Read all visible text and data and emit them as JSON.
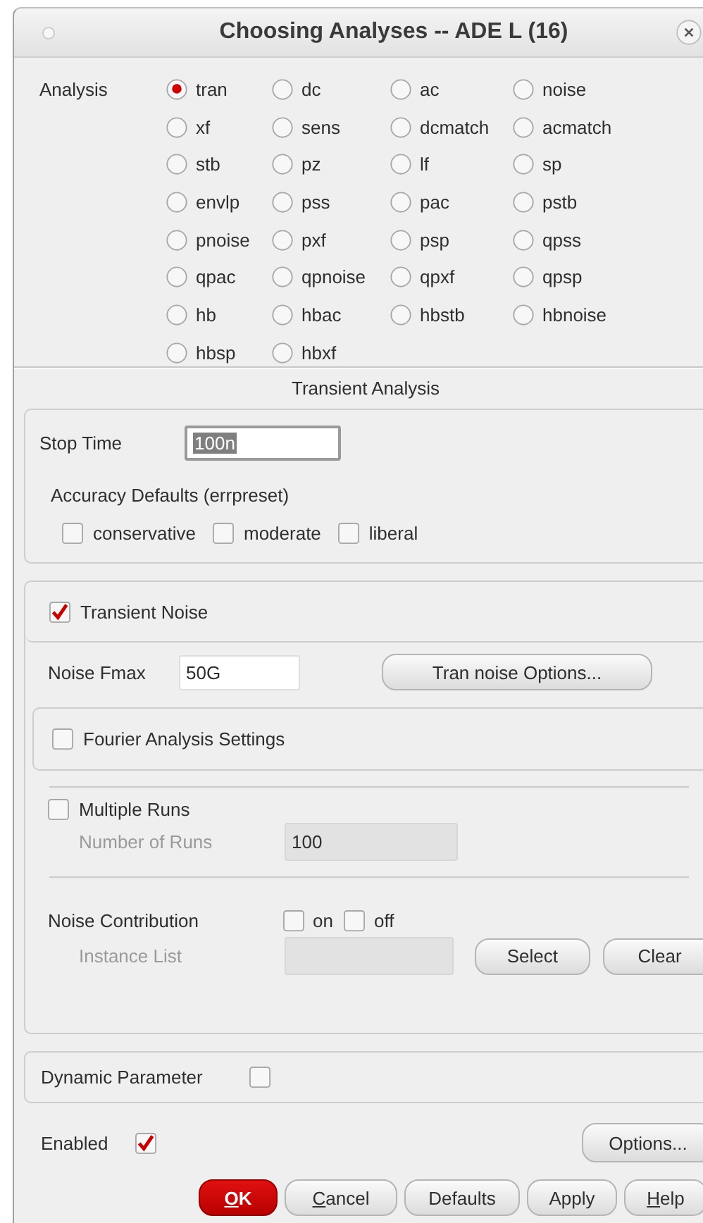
{
  "window": {
    "title": "Choosing Analyses -- ADE L (16)"
  },
  "analysis": {
    "label": "Analysis",
    "options": [
      {
        "label": "tran",
        "selected": true
      },
      {
        "label": "dc",
        "selected": false
      },
      {
        "label": "ac",
        "selected": false
      },
      {
        "label": "noise",
        "selected": false
      },
      {
        "label": "xf",
        "selected": false
      },
      {
        "label": "sens",
        "selected": false
      },
      {
        "label": "dcmatch",
        "selected": false
      },
      {
        "label": "acmatch",
        "selected": false
      },
      {
        "label": "stb",
        "selected": false
      },
      {
        "label": "pz",
        "selected": false
      },
      {
        "label": "lf",
        "selected": false
      },
      {
        "label": "sp",
        "selected": false
      },
      {
        "label": "envlp",
        "selected": false
      },
      {
        "label": "pss",
        "selected": false
      },
      {
        "label": "pac",
        "selected": false
      },
      {
        "label": "pstb",
        "selected": false
      },
      {
        "label": "pnoise",
        "selected": false
      },
      {
        "label": "pxf",
        "selected": false
      },
      {
        "label": "psp",
        "selected": false
      },
      {
        "label": "qpss",
        "selected": false
      },
      {
        "label": "qpac",
        "selected": false
      },
      {
        "label": "qpnoise",
        "selected": false
      },
      {
        "label": "qpxf",
        "selected": false
      },
      {
        "label": "qpsp",
        "selected": false
      },
      {
        "label": "hb",
        "selected": false
      },
      {
        "label": "hbac",
        "selected": false
      },
      {
        "label": "hbstb",
        "selected": false
      },
      {
        "label": "hbnoise",
        "selected": false
      },
      {
        "label": "hbsp",
        "selected": false
      },
      {
        "label": "hbxf",
        "selected": false
      }
    ]
  },
  "section_title": "Transient Analysis",
  "stop_time": {
    "label": "Stop Time",
    "value": "100n",
    "text_selected": true
  },
  "accuracy": {
    "label": "Accuracy Defaults (errpreset)",
    "options": [
      {
        "label": "conservative",
        "checked": false
      },
      {
        "label": "moderate",
        "checked": false
      },
      {
        "label": "liberal",
        "checked": false
      }
    ]
  },
  "transient_noise": {
    "label": "Transient Noise",
    "checked": true,
    "fmax": {
      "label": "Noise Fmax",
      "value": "50G"
    },
    "options_button": "Tran noise Options...",
    "fourier": {
      "label": "Fourier Analysis Settings",
      "checked": false
    },
    "multiple_runs": {
      "label": "Multiple Runs",
      "checked": false,
      "runs": {
        "label": "Number of Runs",
        "value": "100",
        "disabled": true
      }
    },
    "noise_contribution": {
      "label": "Noise Contribution",
      "options": [
        {
          "label": "on",
          "checked": false
        },
        {
          "label": "off",
          "checked": false
        }
      ],
      "instance_list": {
        "label": "Instance List",
        "disabled": true
      },
      "buttons": [
        "Select",
        "Clear"
      ]
    }
  },
  "dynamic_parameter": {
    "label": "Dynamic Parameter",
    "checked": false
  },
  "enabled": {
    "label": "Enabled",
    "checked": true
  },
  "options_button": "Options...",
  "buttons": [
    {
      "kind": "default",
      "mnemonic": "O",
      "rest": "K"
    },
    {
      "kind": "normal",
      "mnemonic": "C",
      "rest": "ancel"
    },
    {
      "kind": "normal",
      "label": "Defaults"
    },
    {
      "kind": "normal",
      "label": "Apply"
    },
    {
      "kind": "normal",
      "mnemonic": "H",
      "rest": "elp"
    }
  ]
}
